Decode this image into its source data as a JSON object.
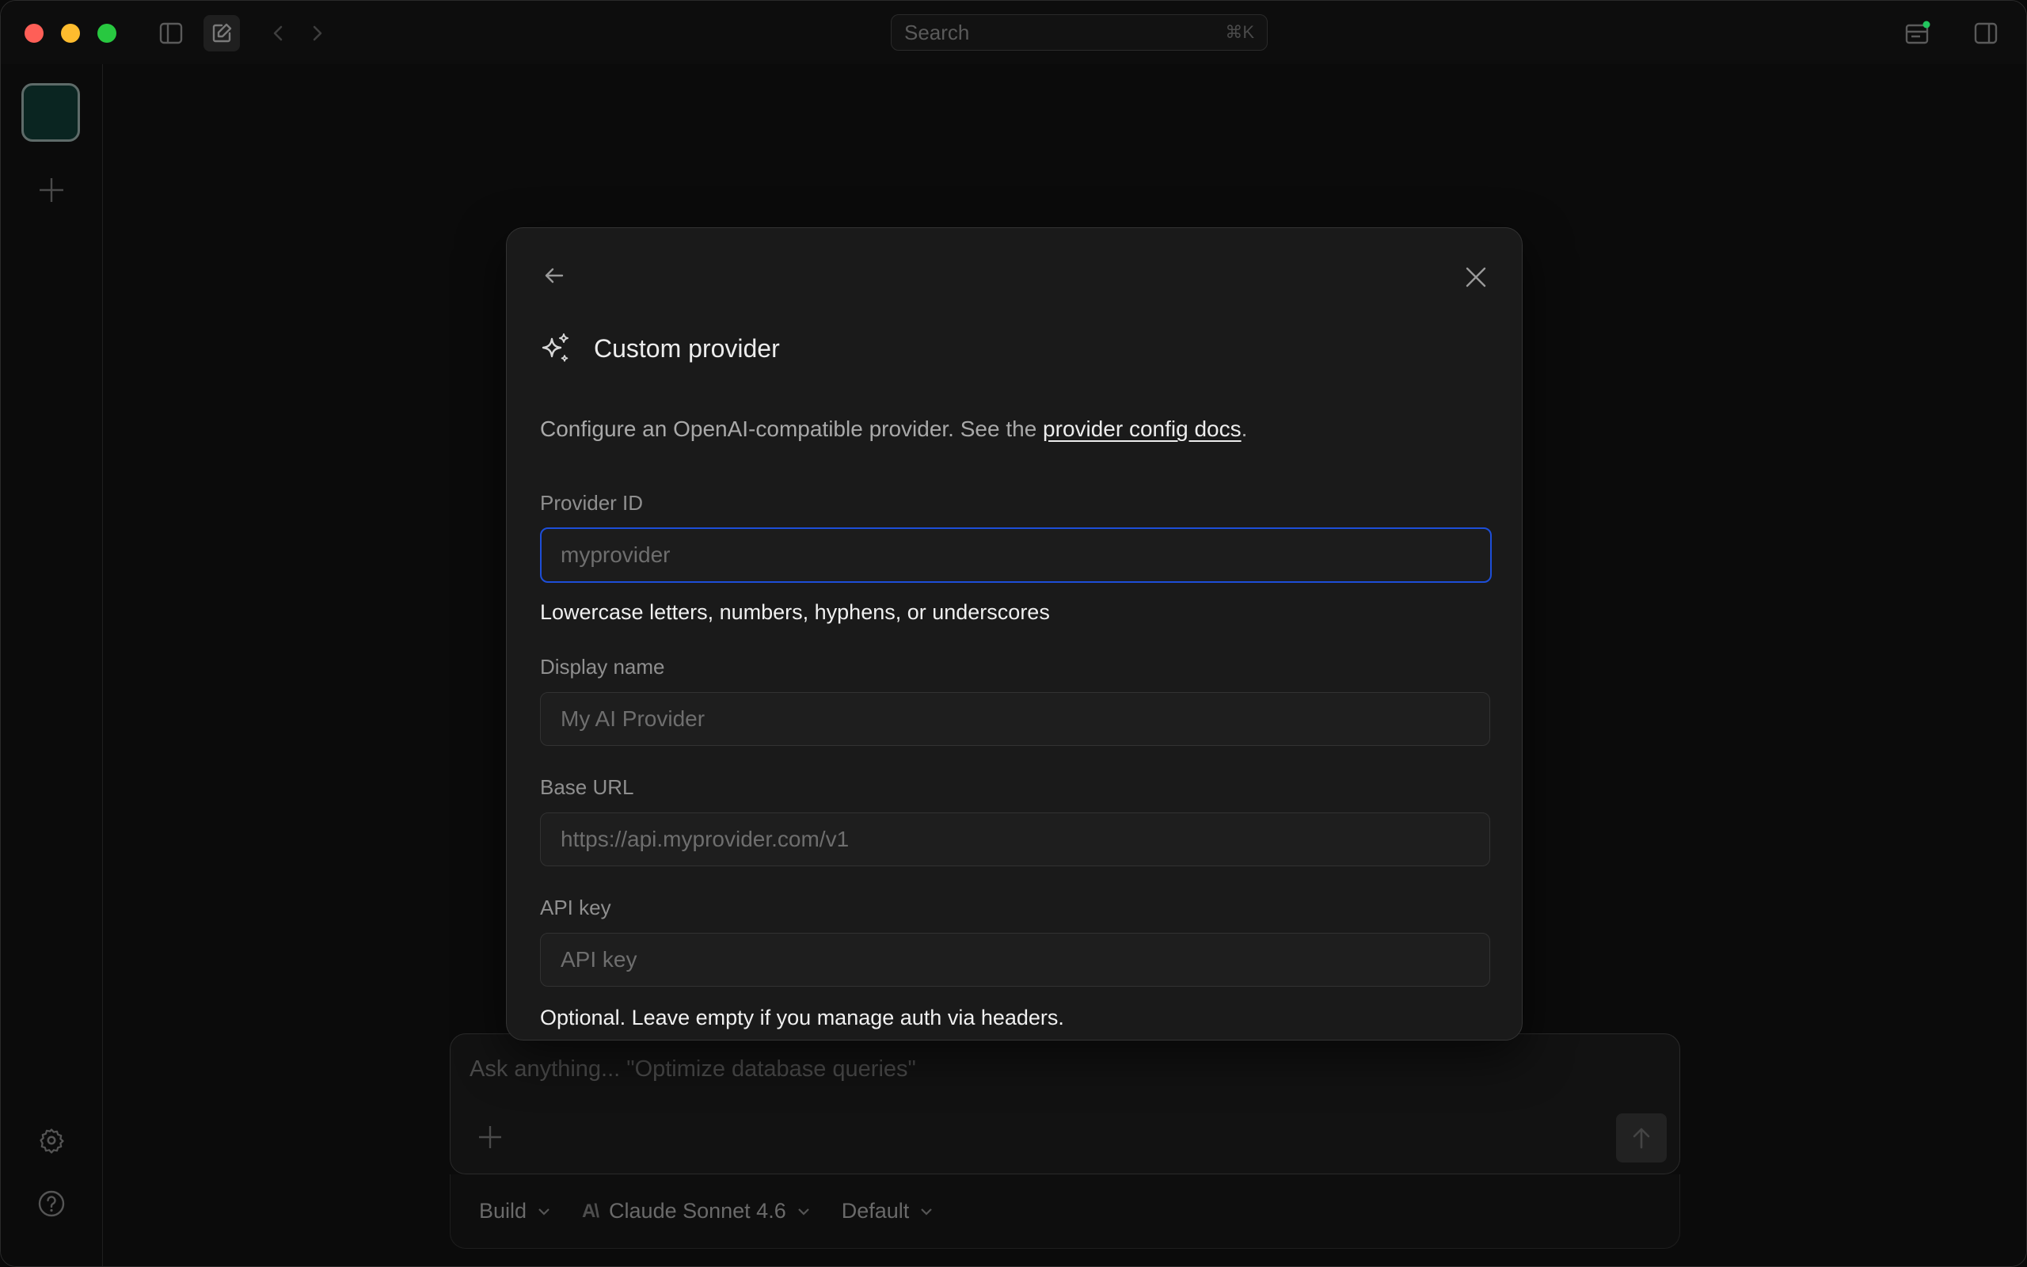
{
  "titlebar": {
    "search_placeholder": "Search",
    "search_shortcut": "⌘K"
  },
  "composer": {
    "placeholder": "Ask anything... \"Optimize database queries\"",
    "mode": "Build",
    "model": "Claude Sonnet 4.6",
    "model_logo": "A\\",
    "preset": "Default"
  },
  "modal": {
    "title": "Custom provider",
    "description_prefix": "Configure an OpenAI-compatible provider. See the ",
    "description_link": "provider config docs",
    "description_suffix": ".",
    "fields": {
      "provider_id": {
        "label": "Provider ID",
        "placeholder": "myprovider",
        "value": "",
        "help": "Lowercase letters, numbers, hyphens, or underscores"
      },
      "display_name": {
        "label": "Display name",
        "placeholder": "My AI Provider",
        "value": ""
      },
      "base_url": {
        "label": "Base URL",
        "placeholder": "https://api.myprovider.com/v1",
        "value": ""
      },
      "api_key": {
        "label": "API key",
        "placeholder": "API key",
        "value": "",
        "help": "Optional. Leave empty if you manage auth via headers."
      }
    }
  },
  "colors": {
    "accent_focus": "#1d4ed8",
    "workspace_tile": "#0a2521",
    "status_dot": "#22c55e"
  },
  "icons": [
    "sidebar-toggle-icon",
    "new-chat-icon",
    "back-arrow-icon",
    "forward-arrow-icon",
    "activity-icon",
    "right-panel-icon",
    "plus-icon",
    "settings-icon",
    "help-icon",
    "sparkles-icon",
    "close-icon",
    "arrow-up-icon",
    "chevron-down-icon"
  ]
}
